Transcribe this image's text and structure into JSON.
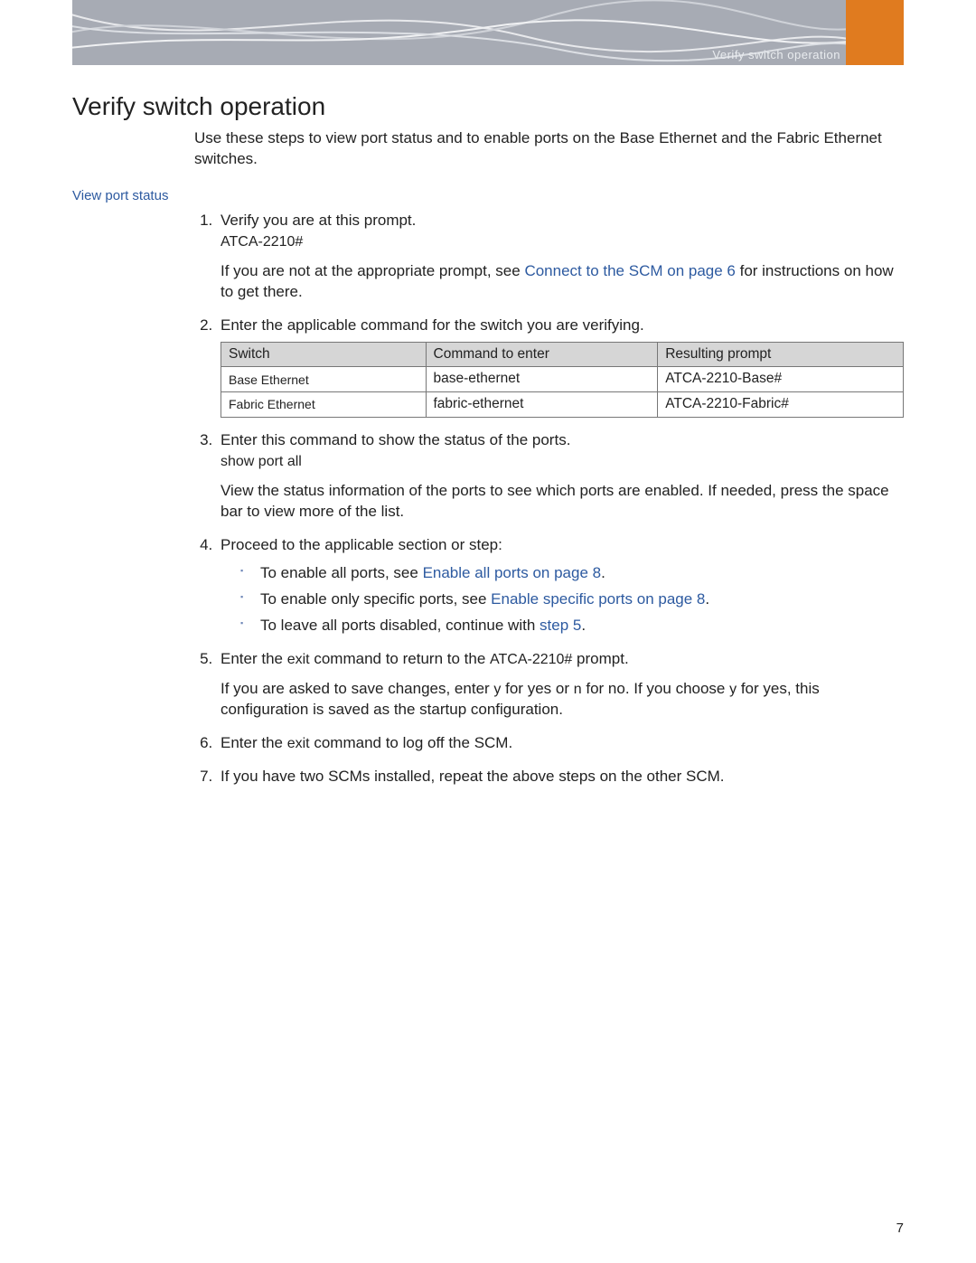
{
  "banner": {
    "caption": "Verify switch operation"
  },
  "title": "Verify switch operation",
  "intro": "Use these steps to view port status and to enable ports on the Base Ethernet and the Fabric Ethernet switches.",
  "subhead": "View port status",
  "steps": {
    "s1_a": "Verify you are at this prompt.",
    "s1_prompt": "ATCA-2210#",
    "s1_b_pre": "If you are not at the appropriate prompt, see ",
    "s1_b_link": "Connect to the SCM on page 6",
    "s1_b_post": " for instructions on how to get there.",
    "s2": "Enter the applicable command for the switch you are verifying.",
    "s3_a": "Enter this command to show the status of the ports.",
    "s3_cmd": "show port all",
    "s3_b": "View the status information of the ports to see which ports are enabled. If needed, press the space bar to view more of the list.",
    "s4": "Proceed to the applicable section or step:",
    "s4_b1_pre": "To enable all ports, see ",
    "s4_b1_link": "Enable all ports on page 8",
    "s4_b1_post": ".",
    "s4_b2_pre": "To enable only specific ports, see ",
    "s4_b2_link": "Enable specific ports on page 8",
    "s4_b2_post": ".",
    "s4_b3_pre": "To leave all ports disabled, continue with ",
    "s4_b3_link": "step 5",
    "s4_b3_post": ".",
    "s5_pre": "Enter the ",
    "s5_cmd": "exit",
    "s5_mid": " command to return to the ",
    "s5_prompt": "ATCA-2210#",
    "s5_post": " prompt.",
    "s5_b_pre": "If you are asked to save changes, enter ",
    "s5_b_y1": "y",
    "s5_b_mid1": " for yes or ",
    "s5_b_n": "n",
    "s5_b_mid2": " for no. If you choose ",
    "s5_b_y2": "y",
    "s5_b_post": " for yes, this configuration is saved as the startup configuration.",
    "s6_pre": "Enter the ",
    "s6_cmd": "exit",
    "s6_post": " command to log off the SCM.",
    "s7": "If you have two SCMs installed, repeat the above steps on the other SCM."
  },
  "table": {
    "headers": [
      "Switch",
      "Command to enter",
      "Resulting prompt"
    ],
    "rows": [
      [
        "Base Ethernet",
        "base-ethernet",
        "ATCA-2210-Base#"
      ],
      [
        "Fabric Ethernet",
        "fabric-ethernet",
        "ATCA-2210-Fabric#"
      ]
    ]
  },
  "page_number": "7"
}
